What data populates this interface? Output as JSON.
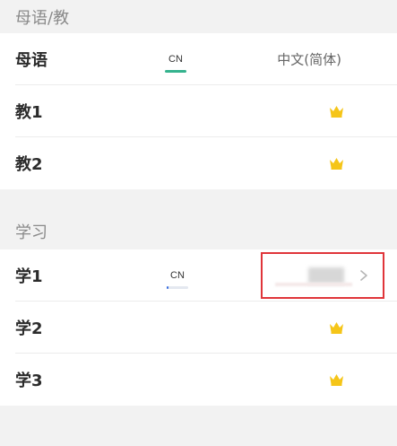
{
  "native_section": {
    "header": "母语/教"
  },
  "native_rows": [
    {
      "label": "母语",
      "chip": "CN",
      "value": "中文(简体)"
    },
    {
      "label": "教1",
      "icon": "crown-icon"
    },
    {
      "label": "教2",
      "icon": "crown-icon"
    }
  ],
  "learn_section": {
    "header": "学习"
  },
  "learn_rows": [
    {
      "label": "学1",
      "chip": "CN",
      "progress": 0.1
    },
    {
      "label": "学2",
      "icon": "crown-icon"
    },
    {
      "label": "学3",
      "icon": "crown-icon"
    }
  ],
  "colors": {
    "accent_green": "#35b38e",
    "accent_blue": "#3a6fe0",
    "crown": "#f5c518",
    "highlight": "#e0353a"
  }
}
